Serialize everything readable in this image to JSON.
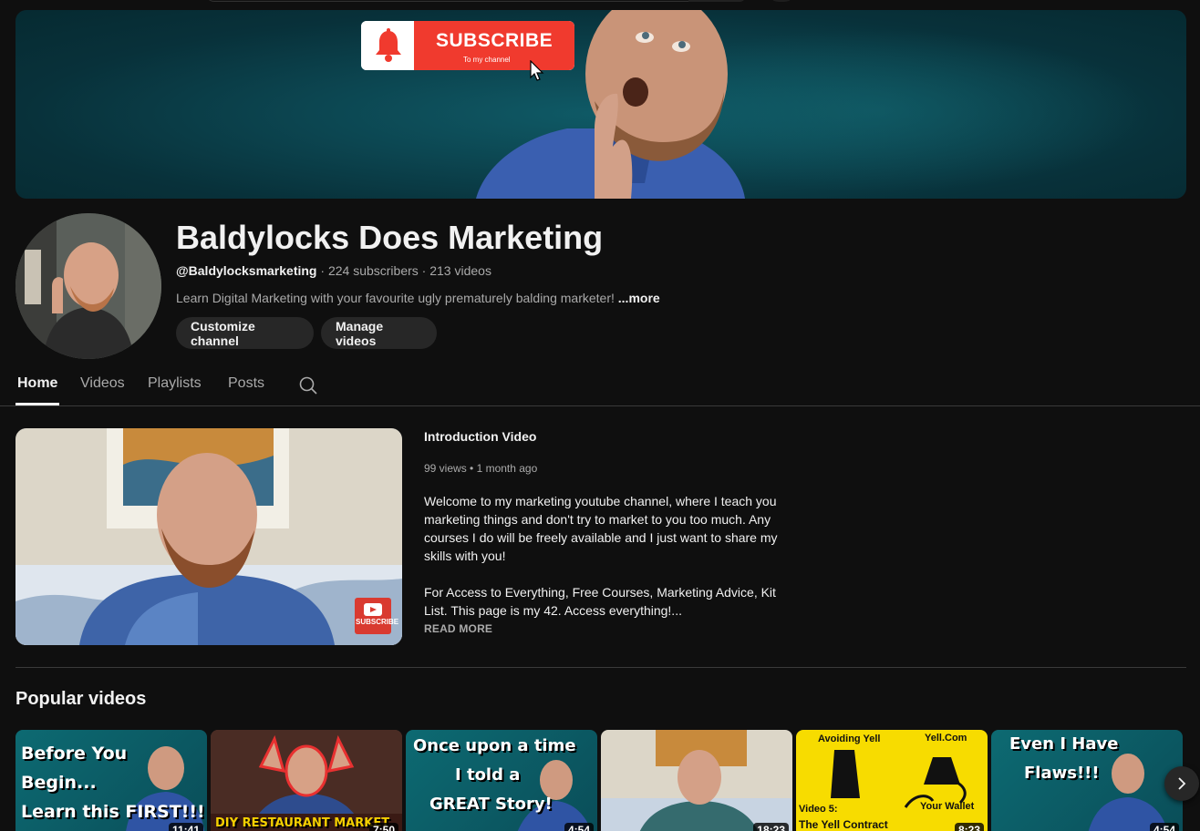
{
  "banner": {
    "subscribe_text": "SUBSCRIBE",
    "subscribe_subtext": "To my channel"
  },
  "channel": {
    "title": "Baldylocks Does Marketing",
    "handle": "@Baldylocksmarketing",
    "subscribers": "224 subscribers",
    "videos_count": "213 videos",
    "separator": " · ",
    "description": "Learn Digital Marketing with your favourite ugly prematurely balding marketer! ",
    "more_label": "...more",
    "customize_label": "Customize channel",
    "manage_label": "Manage videos"
  },
  "tabs": [
    {
      "label": "Home"
    },
    {
      "label": "Videos"
    },
    {
      "label": "Playlists"
    },
    {
      "label": "Posts"
    }
  ],
  "featured": {
    "title": "Introduction Video",
    "views": "99 views",
    "age": "1 month ago",
    "meta_sep": " • ",
    "desc_p1": "Welcome to my marketing youtube channel, where I teach you marketing things and don't try to market to you too much. Any courses I do will be freely available and I just want to share my skills with you!",
    "desc_p2": "For Access to Everything, Free Courses, Marketing Advice, Kit List. This page is my 42. Access everything!...",
    "read_more": "READ MORE",
    "thumb_badge": "SUBSCRIBE"
  },
  "popular": {
    "title": "Popular videos",
    "videos": [
      {
        "caption": [
          "Before You",
          "Begin...",
          "Learn this FIRST!!!"
        ],
        "duration": "11:41"
      },
      {
        "caption": [
          "DIY RESTAURANT MARKET"
        ],
        "duration": "7:50"
      },
      {
        "caption": [
          "Once upon a time",
          "I told a",
          "GREAT Story!"
        ],
        "duration": "4:54"
      },
      {
        "caption": [],
        "duration": "18:23"
      },
      {
        "caption": [
          "Avoiding Yell",
          "Yell.Com",
          "Your Wallet",
          "Video 5:",
          "The Yell Contract"
        ],
        "duration": "8:23"
      },
      {
        "caption": [
          "Even I Have",
          "Flaws!!!"
        ],
        "duration": "4:54"
      }
    ]
  },
  "colors": {
    "background": "#0f0f0f",
    "accent_red": "#f03a2e",
    "pill_bg": "#272727",
    "secondary_text": "#aaaaaa"
  }
}
